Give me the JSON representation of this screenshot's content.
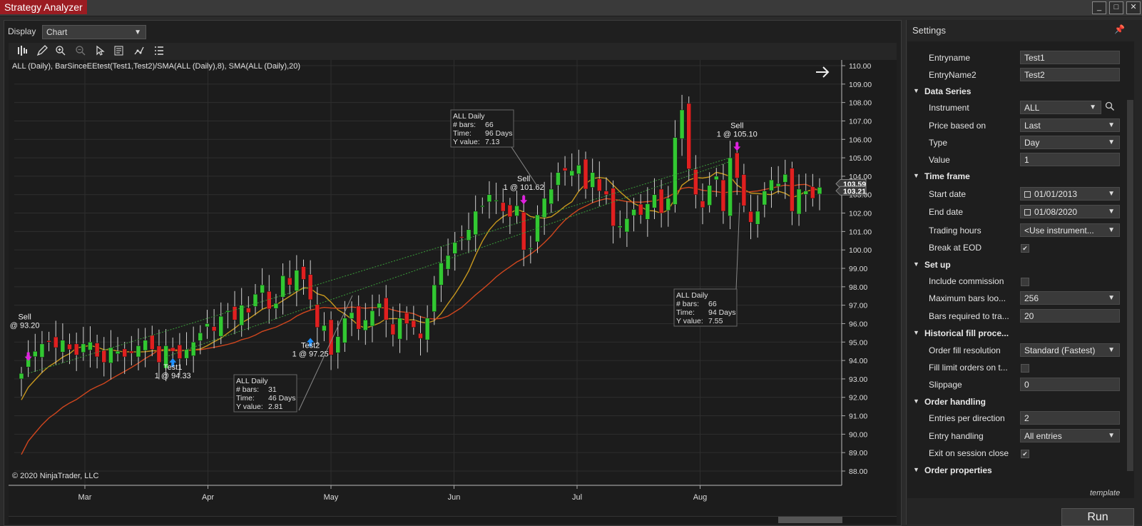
{
  "window": {
    "title": "Strategy Analyzer",
    "controls": [
      "_",
      "□",
      "✕"
    ]
  },
  "display": {
    "label": "Display",
    "value": "Chart"
  },
  "chart": {
    "description": "ALL (Daily), BarSinceEEtest(Test1,Test2)/SMA(ALL (Daily),8), SMA(ALL (Daily),20)",
    "copyright": "© 2020 NinjaTrader, LLC",
    "price_labels": [
      "103.59",
      "103.21"
    ],
    "annotations": [
      {
        "kind": "sell",
        "text1": "Sell",
        "text2": "@ 93.20"
      },
      {
        "kind": "buy",
        "text1": "Test1",
        "text2": "1 @ 94.33"
      },
      {
        "kind": "buy",
        "text1": "Test2",
        "text2": "1 @ 97.25"
      },
      {
        "kind": "sell",
        "text1": "Sell",
        "text2": "1 @ 101.62"
      },
      {
        "kind": "sell",
        "text1": "Sell",
        "text2": "1 @ 105.10"
      }
    ],
    "info_boxes": [
      {
        "title": "ALL Daily",
        "bars": "31",
        "time": "46 Days",
        "yvalue": "2.81"
      },
      {
        "title": "ALL Daily",
        "bars": "66",
        "time": "96 Days",
        "yvalue": "7.13"
      },
      {
        "title": "ALL Daily",
        "bars": "66",
        "time": "94 Days",
        "yvalue": "7.55"
      }
    ],
    "info_labels": {
      "bars": "# bars:",
      "time": "Time:",
      "yvalue": "Y value:"
    }
  },
  "chart_data": {
    "type": "candlestick",
    "title": "ALL (Daily), BarSinceEEtest(Test1,Test2)/SMA(ALL (Daily),8), SMA(ALL (Daily),20)",
    "x_tick_labels": [
      "Mar",
      "Apr",
      "May",
      "Jun",
      "Jul",
      "Aug"
    ],
    "y_tick_labels": [
      "88.00",
      "89.00",
      "90.00",
      "91.00",
      "92.00",
      "93.00",
      "94.00",
      "95.00",
      "96.00",
      "97.00",
      "98.00",
      "99.00",
      "100.00",
      "101.00",
      "102.00",
      "103.00",
      "104.00",
      "105.00",
      "106.00",
      "107.00",
      "108.00",
      "109.00",
      "110.00"
    ],
    "ylim": [
      88,
      110
    ],
    "grid": true,
    "series": [
      {
        "name": "ALL (Daily)",
        "type": "candlestick",
        "close": [
          93.3,
          94.3,
          94.5,
          94.9,
          95.0,
          94.7,
          95.1,
          94.6,
          94.3,
          94.9,
          95.0,
          94.2,
          93.9,
          94.7,
          94.5,
          94.2,
          94.4,
          94.8,
          95.1,
          94.6,
          93.9,
          94.8,
          94.5,
          94.1,
          94.6,
          95.0,
          95.5,
          96.0,
          95.6,
          96.4,
          96.7,
          96.2,
          97.0,
          96.6,
          97.6,
          98.1,
          96.8,
          97.1,
          98.6,
          98.1,
          98.9,
          98.4,
          97.3,
          95.8,
          95.9,
          94.3,
          95.3,
          96.3,
          96.6,
          95.7,
          96.2,
          96.7,
          97.1,
          96.2,
          95.4,
          96.3,
          96.0,
          95.8,
          95.2,
          96.3,
          98.1,
          99.3,
          99.7,
          100.4,
          100.7,
          101.1,
          102.1,
          102.4,
          103.0,
          102.7,
          102.1,
          101.8,
          102.4,
          100.0,
          100.1,
          101.9,
          102.8,
          103.3,
          104.2,
          104.3,
          104.3,
          104.6,
          103.3,
          104.2,
          103.2,
          103.0,
          101.3,
          101.3,
          101.7,
          102.2,
          101.9,
          102.5,
          103.0,
          102.0,
          102.8,
          106.1,
          107.6,
          104.4,
          103.0,
          102.3,
          103.5,
          104.0,
          102.1,
          105.0,
          103.9,
          102.4,
          101.5,
          102.1,
          103.2,
          103.8,
          103.6,
          104.1,
          102.1,
          103.3,
          103.2,
          102.8,
          103.4
        ]
      },
      {
        "name": "SMA(8)",
        "color": "#c8981e"
      },
      {
        "name": "SMA(20)",
        "color": "#d0461e"
      }
    ]
  },
  "settings": {
    "title": "Settings",
    "template_label": "template",
    "run_label": "Run",
    "rows": [
      {
        "type": "field",
        "label": "Entryname",
        "value": "Test1"
      },
      {
        "type": "field",
        "label": "EntryName2",
        "value": "Test2"
      },
      {
        "type": "category",
        "label": "Data Series"
      },
      {
        "type": "dropdown",
        "label": "Instrument",
        "value": "ALL",
        "search": true
      },
      {
        "type": "dropdown",
        "label": "Price based on",
        "value": "Last"
      },
      {
        "type": "dropdown",
        "label": "Type",
        "value": "Day"
      },
      {
        "type": "field",
        "label": "Value",
        "value": "1"
      },
      {
        "type": "category",
        "label": "Time frame"
      },
      {
        "type": "date",
        "label": "Start date",
        "value": "01/01/2013"
      },
      {
        "type": "date",
        "label": "End date",
        "value": "01/08/2020"
      },
      {
        "type": "dropdown",
        "label": "Trading hours",
        "value": "<Use instrument..."
      },
      {
        "type": "check",
        "label": "Break at EOD",
        "value": "✔"
      },
      {
        "type": "category",
        "label": "Set up"
      },
      {
        "type": "check",
        "label": "Include commission",
        "value": ""
      },
      {
        "type": "dropdown",
        "label": "Maximum bars loo...",
        "value": "256"
      },
      {
        "type": "field",
        "label": "Bars required to tra...",
        "value": "20"
      },
      {
        "type": "category",
        "label": "Historical fill proce..."
      },
      {
        "type": "dropdown",
        "label": "Order fill resolution",
        "value": "Standard (Fastest)"
      },
      {
        "type": "check",
        "label": "Fill limit orders on t...",
        "value": ""
      },
      {
        "type": "field",
        "label": "Slippage",
        "value": "0"
      },
      {
        "type": "category",
        "label": "Order handling"
      },
      {
        "type": "field",
        "label": "Entries per direction",
        "value": "2"
      },
      {
        "type": "dropdown",
        "label": "Entry handling",
        "value": "All entries"
      },
      {
        "type": "check",
        "label": "Exit on session close",
        "value": "✔"
      },
      {
        "type": "category",
        "label": "Order properties"
      }
    ]
  }
}
